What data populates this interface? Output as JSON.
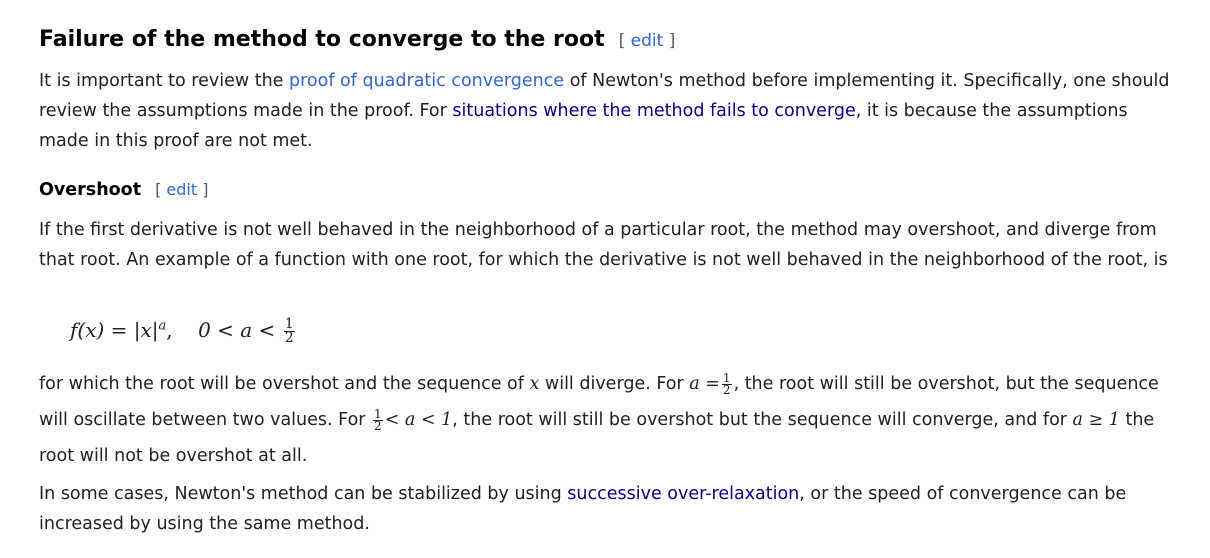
{
  "section": {
    "title": "Failure of the method to converge to the root",
    "edit_open": "[",
    "edit_label": "edit",
    "edit_close": "]"
  },
  "intro": {
    "t1": "It is important to review the ",
    "link1": "proof of quadratic convergence",
    "t2": " of Newton's method before implementing it. Specifically, one should review the assumptions made in the proof. For ",
    "link2": "situations where the method fails to converge",
    "t3": ", it is because the assumptions made in this proof are not met."
  },
  "subsection": {
    "title": "Overshoot",
    "edit_open": "[",
    "edit_label": "edit",
    "edit_close": "]"
  },
  "overshoot": {
    "p1": "If the first derivative is not well behaved in the neighborhood of a particular root, the method may overshoot, and diverge from that root. An example of a function with one root, for which the derivative is not well behaved in the neighborhood of the root, is",
    "equation": {
      "lhs": "f(x) = |x|",
      "exp": "a",
      "sep": ",",
      "cond": "0 < a <",
      "num": "1",
      "den": "2"
    },
    "p2": {
      "t1": "for which the root will be overshot and the sequence of ",
      "x": "x",
      "t2": " will diverge. For ",
      "a_eq": "a =",
      "t3": ", the root will still be overshot, but the sequence will oscillate between two values. For ",
      "cond2": "< a < 1",
      "t4": ", the root will still be overshot but the sequence will converge, and for ",
      "cond3": "a ≥ 1",
      "t5": " the root will not be overshot at all."
    },
    "p3": {
      "t1": "In some cases, Newton's method can be stabilized by using ",
      "link": "successive over-relaxation",
      "t2": ", or the speed of convergence can be increased by using the same method."
    }
  }
}
